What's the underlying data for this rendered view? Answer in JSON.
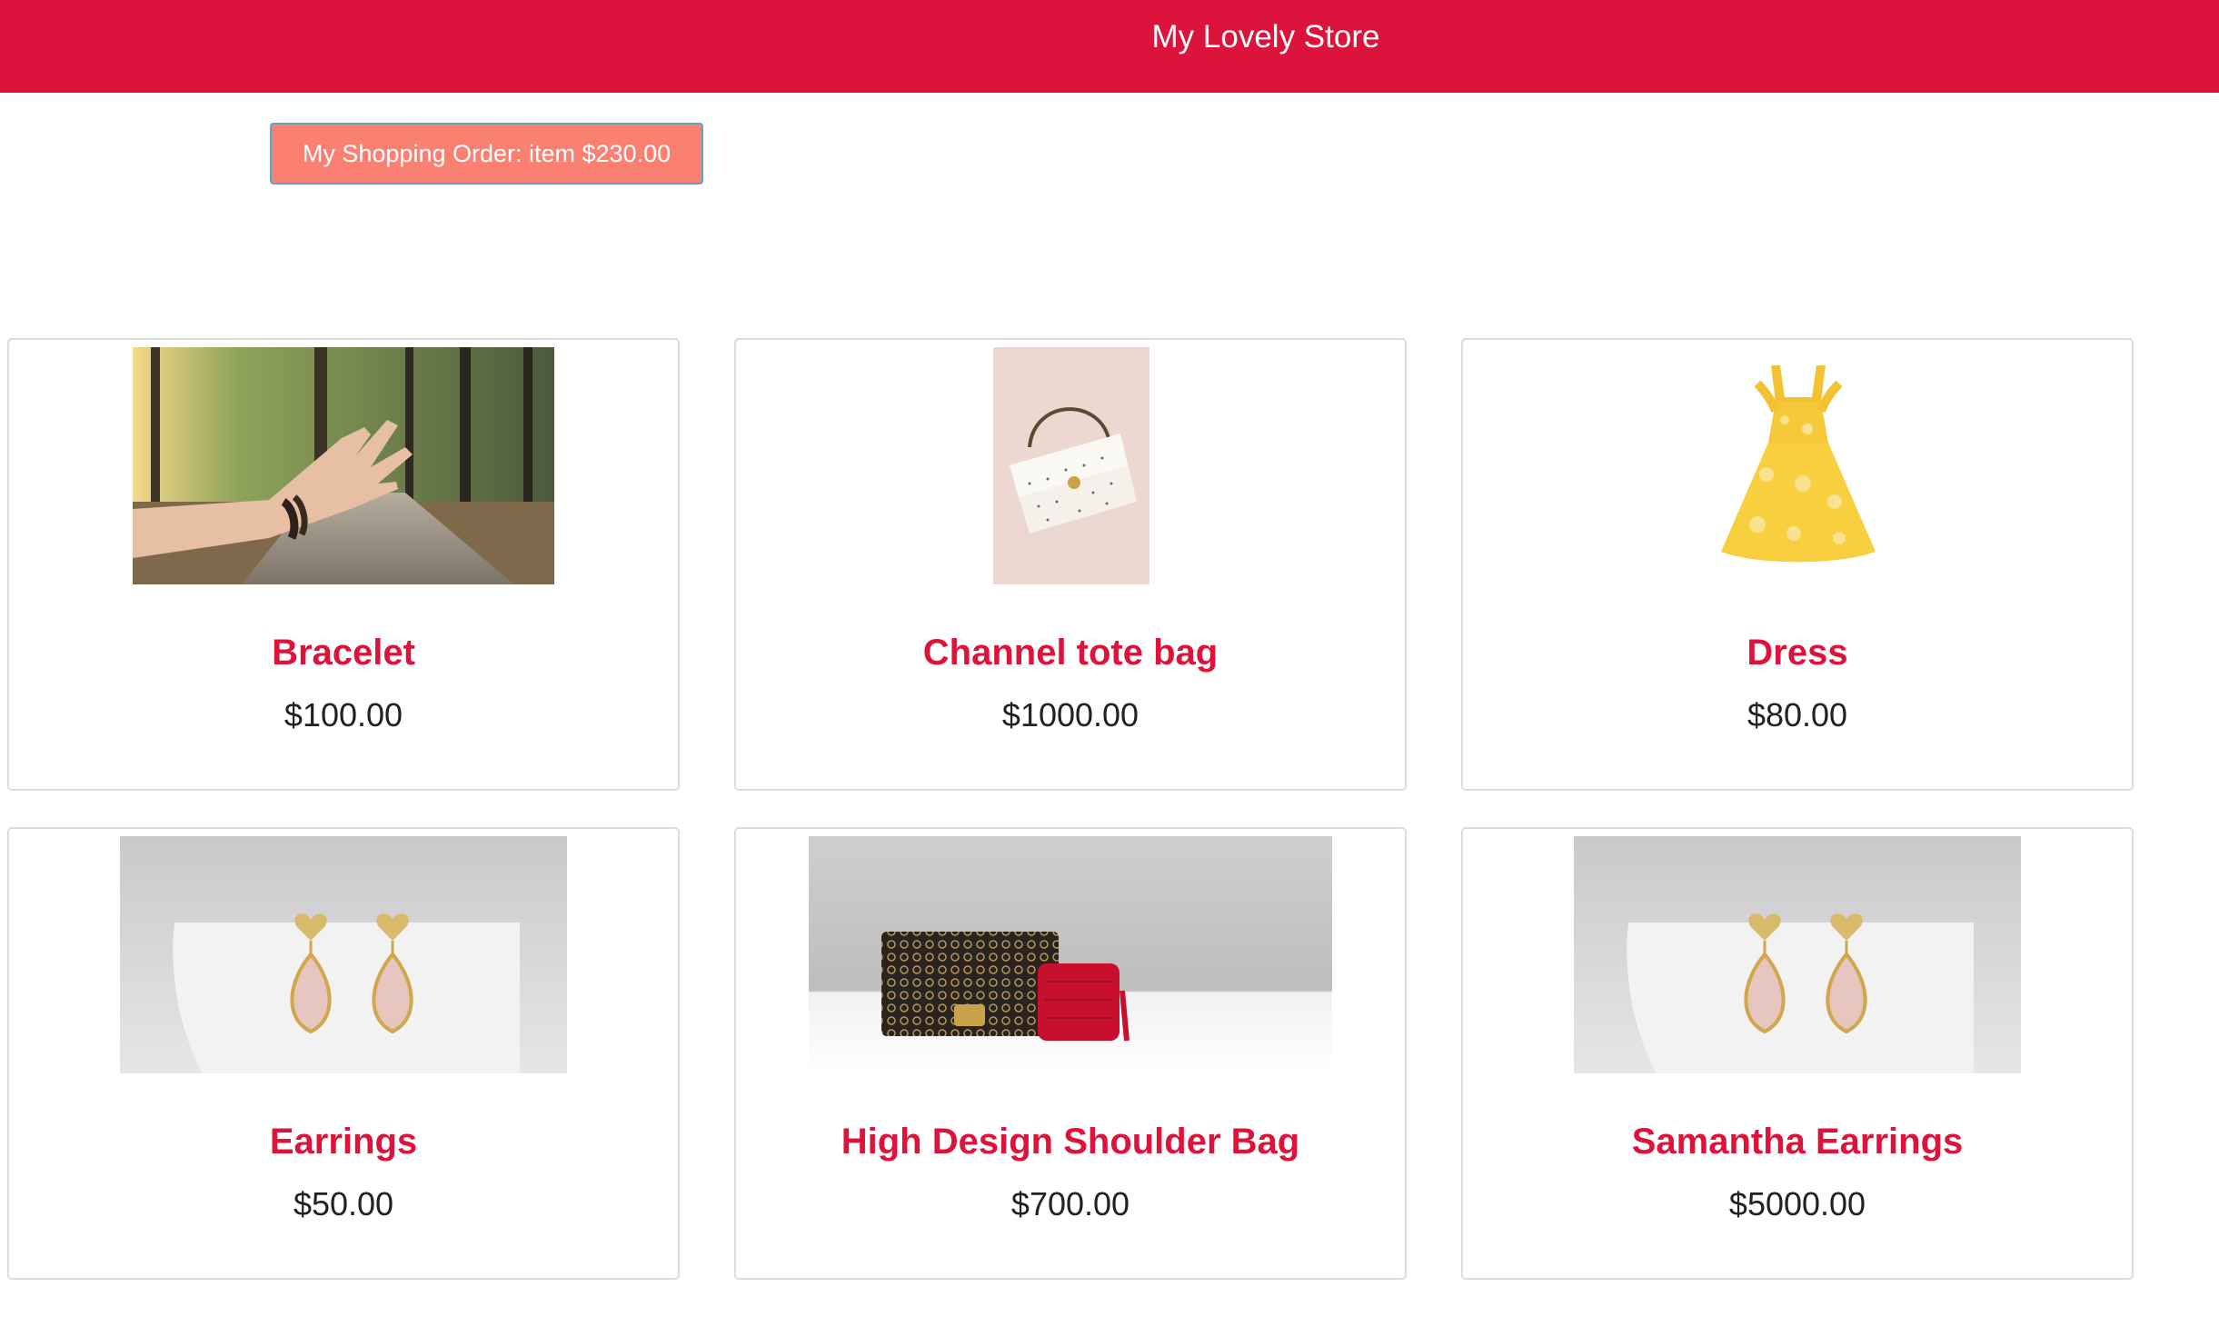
{
  "header": {
    "title": "My Lovely Store",
    "background_color": "#dc143c"
  },
  "order": {
    "label": "My Shopping Order: item $230.00",
    "button_color": "#fa8072"
  },
  "products": [
    {
      "name": "Bracelet",
      "price": "$100.00",
      "image": "bracelet-on-hand-photo"
    },
    {
      "name": "Channel tote bag",
      "price": "$1000.00",
      "image": "white-handbag-photo"
    },
    {
      "name": "Dress",
      "price": "$80.00",
      "image": "yellow-dress-photo"
    },
    {
      "name": "Earrings",
      "price": "$50.00",
      "image": "heart-earrings-photo"
    },
    {
      "name": "High Design Shoulder Bag",
      "price": "$700.00",
      "image": "wallet-and-case-photo"
    },
    {
      "name": "Samantha Earrings",
      "price": "$5000.00",
      "image": "heart-earrings-photo"
    }
  ]
}
